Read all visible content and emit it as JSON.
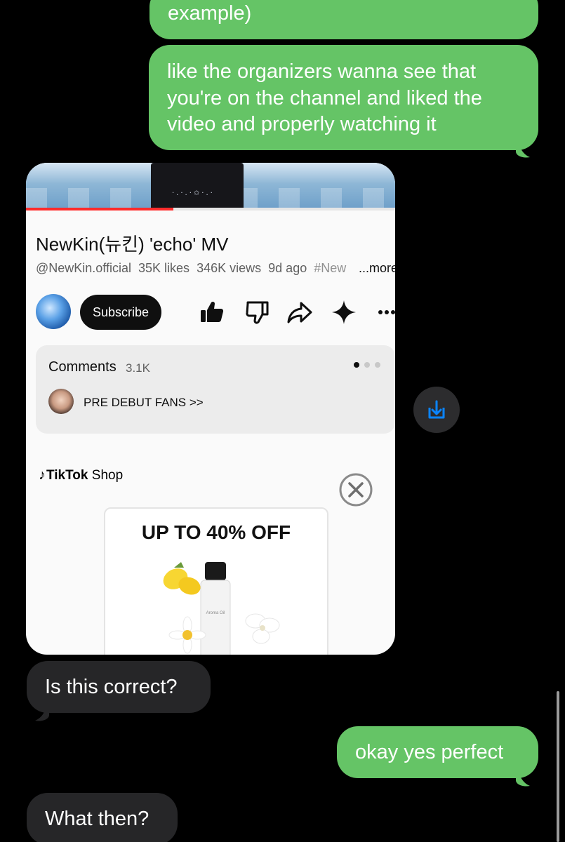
{
  "messages": {
    "sent_1": "example)",
    "sent_2": "like the organizers wanna see that you're on the channel and liked the video and properly watching it",
    "received_1": "Is this correct?",
    "sent_3": "okay yes perfect",
    "received_2": "What then?"
  },
  "attachment": {
    "video": {
      "title": "NewKin(뉴킨) 'echo' MV",
      "channel": "@NewKin.official",
      "likes": "35K likes",
      "views": "346K views",
      "age": "9d ago",
      "hashtag": "#New",
      "more": "...more",
      "progress_fraction": 0.4
    },
    "subscribe_label": "Subscribe",
    "comments": {
      "label": "Comments",
      "count": "3.1K",
      "top_comment": "PRE DEBUT FANS >>"
    },
    "ad": {
      "brand": "TikTok",
      "brand_suffix": "Shop",
      "headline": "UP TO 40% OFF",
      "product_label": "Aroma Oil"
    }
  },
  "colors": {
    "sent_bubble": "#65c466",
    "received_bubble": "#262628",
    "save_button_icon": "#0a84ff"
  },
  "icons": [
    "like-icon",
    "dislike-icon",
    "share-icon",
    "sparkle-icon",
    "more-icon",
    "close-icon",
    "save-to-files-icon"
  ]
}
